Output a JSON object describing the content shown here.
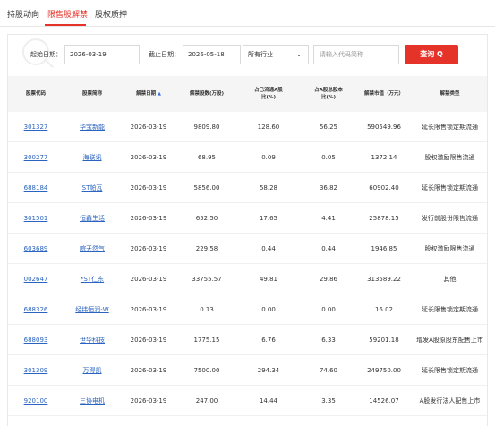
{
  "tabs": [
    {
      "label": "持股动向"
    },
    {
      "label": "限售股解禁"
    },
    {
      "label": "股权质押"
    }
  ],
  "filter": {
    "start_label": "起始日期：",
    "start_value": "2026-03-19",
    "end_label": "截止日期：",
    "end_value": "2026-05-18",
    "industry_value": "所有行业",
    "code_placeholder": "请输入代码简称",
    "query_label": "查询 Q"
  },
  "colors": {
    "accent": "#e5332a",
    "link": "#2a63c0"
  },
  "table": {
    "columns": [
      "股票代码",
      "股票简称",
      "解禁日期",
      "解禁股数(万股)",
      "占已流通A股比(%)",
      "占A股总股本比(%)",
      "解禁市值（万元）",
      "解禁类型"
    ],
    "sorted_column": "解禁日期",
    "sort_icon": "▲",
    "rows": [
      [
        "301327",
        "华宝新能",
        "2026-03-19",
        "9809.80",
        "128.60",
        "56.25",
        "590549.96",
        "延长限售锁定期流通"
      ],
      [
        "300277",
        "海联讯",
        "2026-03-19",
        "68.95",
        "0.09",
        "0.05",
        "1372.14",
        "股权激励限售流通"
      ],
      [
        "688184",
        "ST帕瓦",
        "2026-03-19",
        "5856.00",
        "58.28",
        "36.82",
        "60902.40",
        "延长限售锁定期流通"
      ],
      [
        "301501",
        "恒鑫生活",
        "2026-03-19",
        "652.50",
        "17.65",
        "4.41",
        "25878.15",
        "发行前股份限售流通"
      ],
      [
        "603689",
        "皖天然气",
        "2026-03-19",
        "229.58",
        "0.44",
        "0.44",
        "1946.85",
        "股权激励限售流通"
      ],
      [
        "002647",
        "*ST仁东",
        "2026-03-19",
        "33755.57",
        "49.81",
        "29.86",
        "313589.22",
        "其他"
      ],
      [
        "688326",
        "经纬恒润-W",
        "2026-03-19",
        "0.13",
        "0.00",
        "0.00",
        "16.02",
        "延长限售锁定期流通"
      ],
      [
        "688093",
        "世华科技",
        "2026-03-19",
        "1775.15",
        "6.76",
        "6.33",
        "59201.18",
        "增发A股原股东配售上市"
      ],
      [
        "301309",
        "万得凯",
        "2026-03-19",
        "7500.00",
        "294.34",
        "74.60",
        "249750.00",
        "延长限售锁定期流通"
      ],
      [
        "920100",
        "三协电机",
        "2026-03-19",
        "247.00",
        "14.44",
        "3.35",
        "14526.07",
        "A股发行法人配售上市"
      ]
    ]
  }
}
